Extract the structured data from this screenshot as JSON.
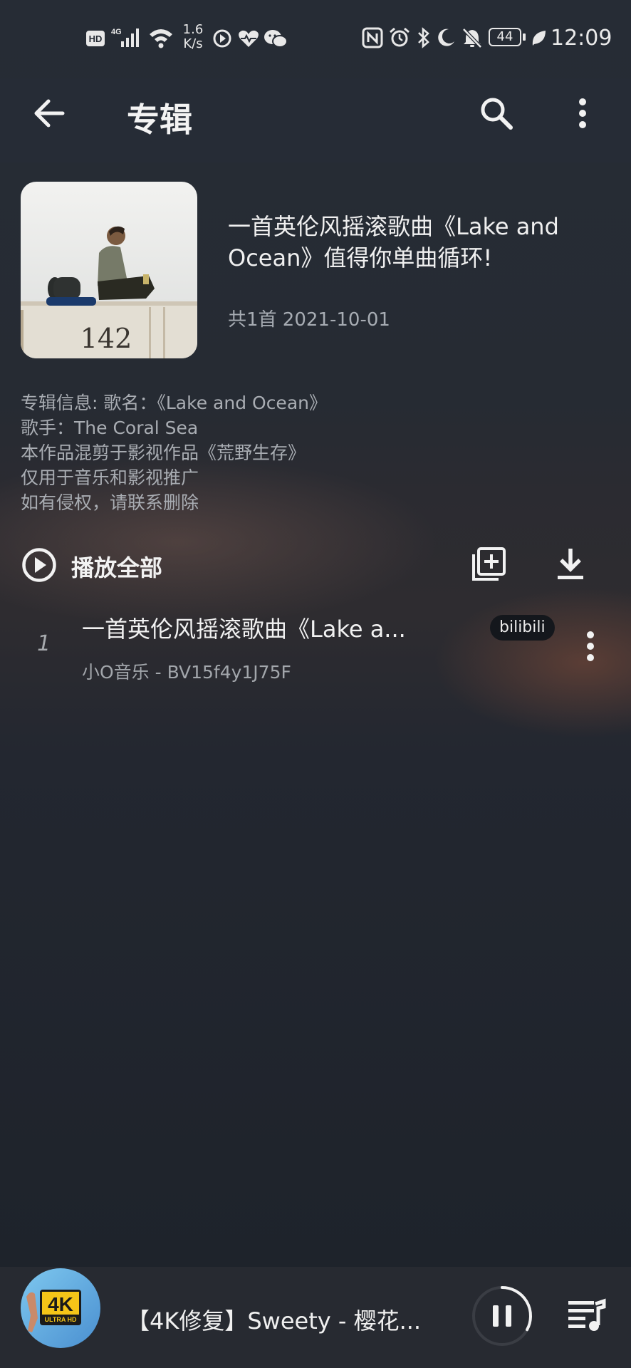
{
  "status_bar": {
    "network_speed_value": "1.6",
    "network_speed_unit": "K/s",
    "battery": "44",
    "time": "12:09"
  },
  "header": {
    "title": "专辑"
  },
  "album": {
    "title_line1": "一首英伦风摇滚歌曲《Lake and",
    "title_line2": "Ocean》值得你单曲循环!",
    "meta": "共1首 2021-10-01",
    "cover_number": "142",
    "description": [
      "专辑信息: 歌名：《Lake and Ocean》",
      "歌手：The Coral Sea",
      "本作品混剪于影视作品《荒野生存》",
      "仅用于音乐和影视推广",
      "如有侵权，请联系删除"
    ]
  },
  "actions": {
    "play_all_label": "播放全部"
  },
  "songs": [
    {
      "index": "1",
      "title": "一首英伦风摇滚歌曲《Lake a...",
      "subtitle": "小O音乐 - BV15f4y1J75F",
      "source_badge": "bilibili"
    }
  ],
  "mini_player": {
    "title": "【4K修复】Sweety - 樱花...",
    "cover_badge_main": "4K",
    "cover_badge_sub": "ULTRA HD",
    "progress": 0.33
  },
  "colors": {
    "background": "#262c35",
    "secondary_text": "#a9adb3",
    "badge_bg": "#14171c"
  }
}
